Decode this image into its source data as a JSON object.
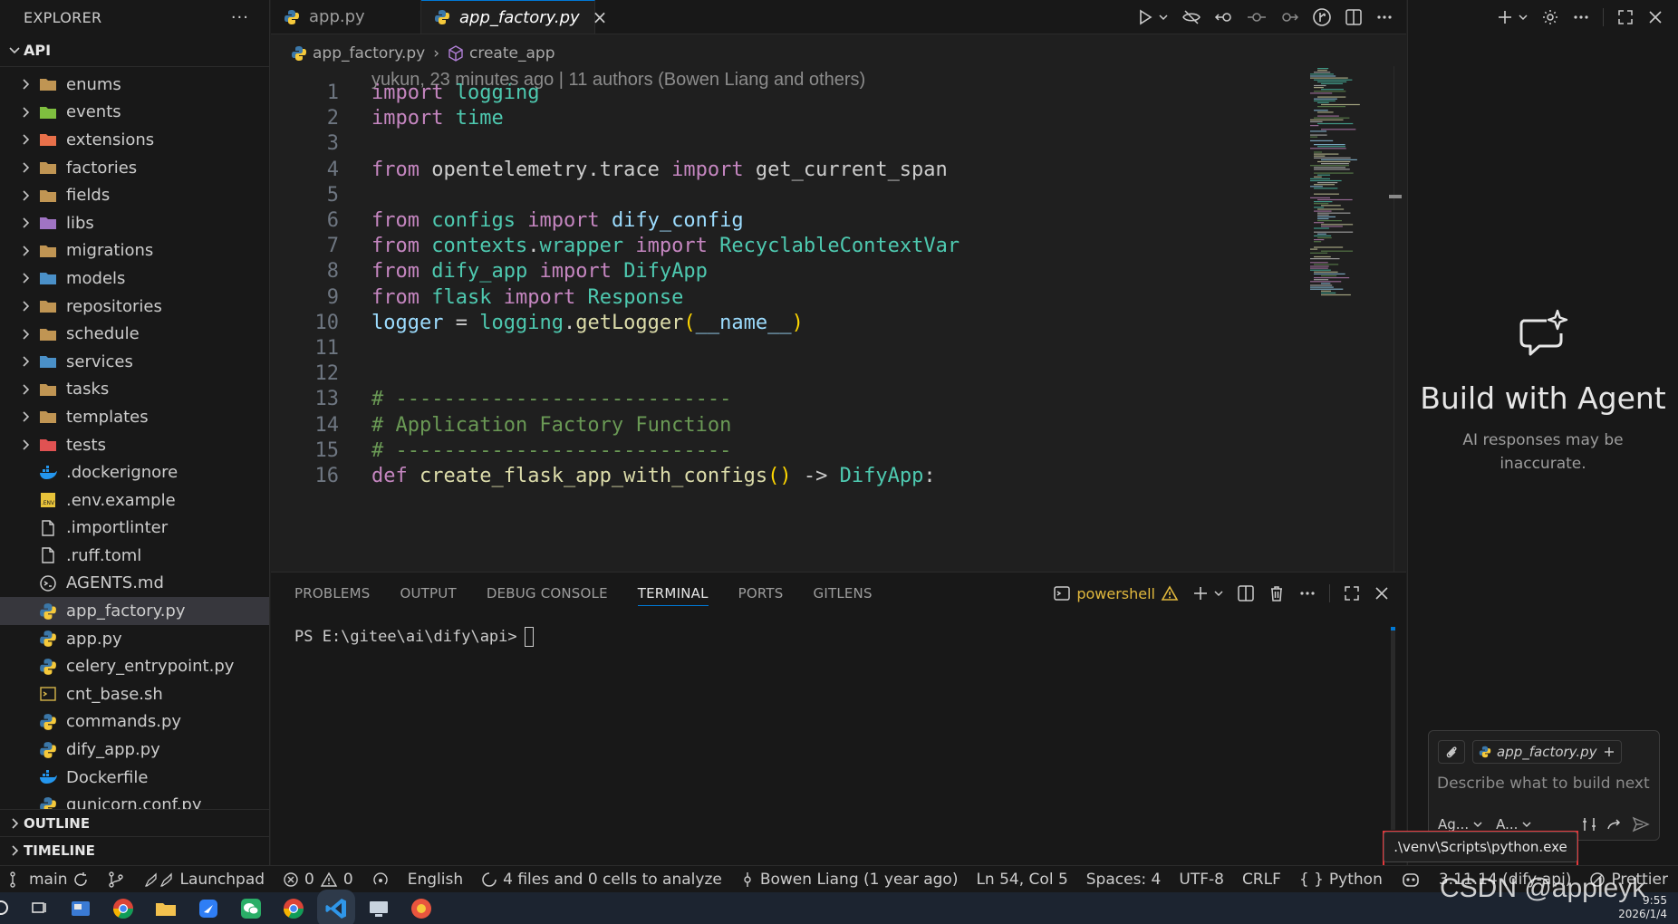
{
  "sidebar": {
    "header": "EXPLORER",
    "more": "···",
    "section": "API",
    "folders": [
      {
        "label": "enums",
        "icon": "folder-icon",
        "color": "#c09553"
      },
      {
        "label": "events",
        "icon": "folder-events-icon",
        "color": "#7fbf3f"
      },
      {
        "label": "extensions",
        "icon": "folder-extensions-icon",
        "color": "#e8704a"
      },
      {
        "label": "factories",
        "icon": "folder-icon",
        "color": "#c09553"
      },
      {
        "label": "fields",
        "icon": "folder-icon",
        "color": "#c09553"
      },
      {
        "label": "libs",
        "icon": "folder-libs-icon",
        "color": "#a074c4"
      },
      {
        "label": "migrations",
        "icon": "folder-icon",
        "color": "#c09553"
      },
      {
        "label": "models",
        "icon": "folder-models-icon",
        "color": "#4a90c8"
      },
      {
        "label": "repositories",
        "icon": "folder-repositories-icon",
        "color": "#c09553"
      },
      {
        "label": "schedule",
        "icon": "folder-icon",
        "color": "#c09553"
      },
      {
        "label": "services",
        "icon": "folder-services-icon",
        "color": "#4a90c8"
      },
      {
        "label": "tasks",
        "icon": "folder-icon",
        "color": "#c09553"
      },
      {
        "label": "templates",
        "icon": "folder-icon",
        "color": "#c09553"
      },
      {
        "label": "tests",
        "icon": "folder-tests-icon",
        "color": "#e05252"
      }
    ],
    "files": [
      {
        "label": ".dockerignore",
        "icon": "docker-icon"
      },
      {
        "label": ".env.example",
        "icon": "env-icon"
      },
      {
        "label": ".importlinter",
        "icon": "file-icon"
      },
      {
        "label": ".ruff.toml",
        "icon": "file-icon"
      },
      {
        "label": "AGENTS.md",
        "icon": "agents-icon"
      },
      {
        "label": "app_factory.py",
        "icon": "python-icon"
      },
      {
        "label": "app.py",
        "icon": "python-icon"
      },
      {
        "label": "celery_entrypoint.py",
        "icon": "python-icon"
      },
      {
        "label": "cnt_base.sh",
        "icon": "shell-icon"
      },
      {
        "label": "commands.py",
        "icon": "python-icon"
      },
      {
        "label": "dify_app.py",
        "icon": "python-icon"
      },
      {
        "label": "Dockerfile",
        "icon": "docker-icon"
      },
      {
        "label": "gunicorn.conf.py",
        "icon": "python-icon"
      }
    ],
    "outline": "OUTLINE",
    "timeline": "TIMELINE"
  },
  "editor": {
    "tabs": [
      {
        "label": "app.py",
        "active": false
      },
      {
        "label": "app_factory.py",
        "active": true,
        "close": "×"
      }
    ],
    "breadcrumb": {
      "file": "app_factory.py",
      "symbol": "create_app",
      "sep": "›"
    },
    "blame": "yukun, 23 minutes ago | 11 authors (Bowen Liang and others)",
    "line_numbers": [
      "1",
      "2",
      "3",
      "4",
      "5",
      "6",
      "7",
      "8",
      "9",
      "10",
      "11",
      "12",
      "13",
      "14",
      "15",
      "16"
    ],
    "code_lines": [
      [
        {
          "t": "import",
          "c": "kw"
        },
        {
          "t": " ",
          "c": "pl"
        },
        {
          "t": "logging",
          "c": "mod"
        }
      ],
      [
        {
          "t": "import",
          "c": "kw"
        },
        {
          "t": " ",
          "c": "pl"
        },
        {
          "t": "time",
          "c": "mod"
        }
      ],
      [],
      [
        {
          "t": "from",
          "c": "kw"
        },
        {
          "t": " opentelemetry.trace ",
          "c": "pl"
        },
        {
          "t": "import",
          "c": "kw"
        },
        {
          "t": " get_current_span",
          "c": "pl"
        }
      ],
      [],
      [
        {
          "t": "from",
          "c": "kw"
        },
        {
          "t": " ",
          "c": "pl"
        },
        {
          "t": "configs",
          "c": "mod"
        },
        {
          "t": " ",
          "c": "pl"
        },
        {
          "t": "import",
          "c": "kw"
        },
        {
          "t": " ",
          "c": "pl"
        },
        {
          "t": "dify_config",
          "c": "var"
        }
      ],
      [
        {
          "t": "from",
          "c": "kw"
        },
        {
          "t": " ",
          "c": "pl"
        },
        {
          "t": "contexts",
          "c": "mod"
        },
        {
          "t": ".",
          "c": "pl"
        },
        {
          "t": "wrapper",
          "c": "mod"
        },
        {
          "t": " ",
          "c": "pl"
        },
        {
          "t": "import",
          "c": "kw"
        },
        {
          "t": " ",
          "c": "pl"
        },
        {
          "t": "RecyclableContextVar",
          "c": "cls"
        }
      ],
      [
        {
          "t": "from",
          "c": "kw"
        },
        {
          "t": " ",
          "c": "pl"
        },
        {
          "t": "dify_app",
          "c": "mod"
        },
        {
          "t": " ",
          "c": "pl"
        },
        {
          "t": "import",
          "c": "kw"
        },
        {
          "t": " ",
          "c": "pl"
        },
        {
          "t": "DifyApp",
          "c": "cls"
        }
      ],
      [
        {
          "t": "from",
          "c": "kw"
        },
        {
          "t": " ",
          "c": "pl"
        },
        {
          "t": "flask",
          "c": "mod"
        },
        {
          "t": " ",
          "c": "pl"
        },
        {
          "t": "import",
          "c": "kw"
        },
        {
          "t": " ",
          "c": "pl"
        },
        {
          "t": "Response",
          "c": "cls"
        }
      ],
      [
        {
          "t": "logger",
          "c": "var"
        },
        {
          "t": " = ",
          "c": "pl"
        },
        {
          "t": "logging",
          "c": "mod"
        },
        {
          "t": ".",
          "c": "pl"
        },
        {
          "t": "getLogger",
          "c": "fn"
        },
        {
          "t": "(",
          "c": "par"
        },
        {
          "t": "__name__",
          "c": "var"
        },
        {
          "t": ")",
          "c": "par"
        }
      ],
      [],
      [],
      [
        {
          "t": "# ----------------------------",
          "c": "cm"
        }
      ],
      [
        {
          "t": "# Application Factory Function",
          "c": "cm"
        }
      ],
      [
        {
          "t": "# ----------------------------",
          "c": "cm"
        }
      ],
      [
        {
          "t": "def",
          "c": "kw"
        },
        {
          "t": " ",
          "c": "pl"
        },
        {
          "t": "create_flask_app_with_configs",
          "c": "fn"
        },
        {
          "t": "()",
          "c": "par"
        },
        {
          "t": " -> ",
          "c": "pl"
        },
        {
          "t": "DifyApp",
          "c": "cls"
        },
        {
          "t": ":",
          "c": "pl"
        }
      ]
    ]
  },
  "panel": {
    "tabs": [
      "PROBLEMS",
      "OUTPUT",
      "DEBUG CONSOLE",
      "TERMINAL",
      "PORTS",
      "GITLENS"
    ],
    "active_tab": "TERMINAL",
    "shell": "powershell",
    "prompt": "PS E:\\gitee\\ai\\dify\\api>"
  },
  "agent": {
    "title": "Build with Agent",
    "subtitle": "AI responses may be inaccurate.",
    "context_file": "app_factory.py",
    "input_placeholder": "Describe what to build next",
    "mode_label": "Ag...",
    "model_label": "A..."
  },
  "tooltip": ".\\venv\\Scripts\\python.exe",
  "statusbar": {
    "branch": "main",
    "launchpad": "Launchpad",
    "errors": "0",
    "warnings": "0",
    "language_locale": "English",
    "analyze": "4 files and 0 cells to analyze",
    "blame": "Bowen Liang (1 year ago)",
    "position": "Ln 54, Col 5",
    "spaces": "Spaces: 4",
    "encoding": "UTF-8",
    "eol": "CRLF",
    "language": "Python",
    "interpreter": "3.11.14 (dify-api)",
    "prettier": "Prettier"
  },
  "taskbar": {
    "time": "9:55",
    "date": "2026/1/4"
  },
  "watermark": "CSDN @appleyk",
  "colors": {
    "accent": "#0078d4",
    "warning": "#e2b93d",
    "highlight_box": "#e5383b"
  }
}
